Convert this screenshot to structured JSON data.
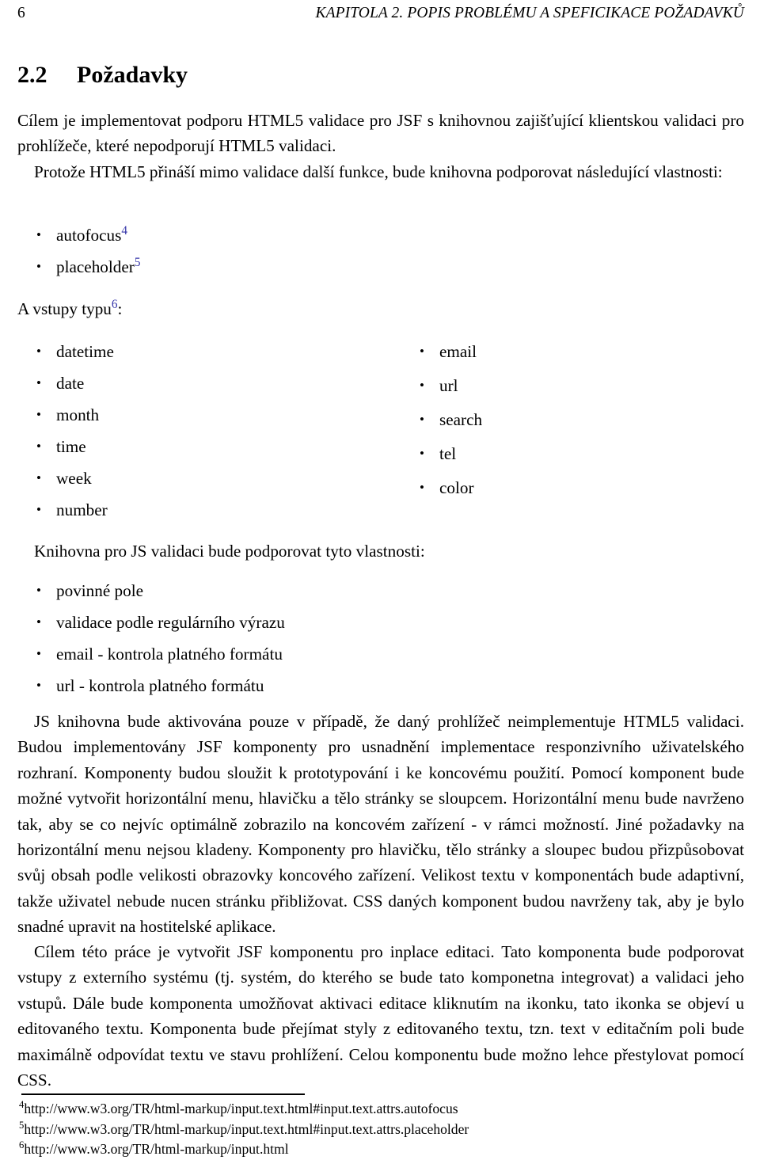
{
  "page": {
    "folio": "6",
    "running_head": "KAPITOLA 2. POPIS PROBLÉMU A SPEFICIKACE POŽADAVKŮ"
  },
  "section": {
    "number": "2.2",
    "title": "Požadavky"
  },
  "paragraphs": {
    "intro": "Cílem je implementovat podporu HTML5 validace pro JSF s knihovnou zajišťující klientskou validaci pro prohlížeče, které nepodporují HTML5 validaci.",
    "features_lead": "Protože HTML5 přináší mimo validace další funkce, bude knihovna podporovat následující vlastnosti:",
    "types_lead_before": "A vstupy typu",
    "types_lead_after": ":",
    "js_lead": "Knihovna pro JS validaci bude podporovat tyto vlastnosti:",
    "big_one": "JS knihovna bude aktivována pouze v případě, že daný prohlížeč neimplementuje HTML5 validaci. Budou implementovány JSF komponenty pro usnadnění implementace responzivního uživatelského rozhraní. Komponenty budou sloužit k prototypování i ke koncovému použití. Pomocí komponent bude možné vytvořit horizontální menu, hlavičku a tělo stránky se sloupcem. Horizontální menu bude navrženo tak, aby se co nejvíc optimálně zobrazilo na koncovém zařízení - v rámci možností. Jiné požadavky na horizontální menu nejsou kladeny. Komponenty pro hlavičku, tělo stránky a sloupec budou přizpůsobovat svůj obsah podle velikosti obrazovky koncového zařízení. Velikost textu v komponentách bude adaptivní, takže uživatel nebude nucen stránku přibližovat. CSS daných komponent budou navrženy tak, aby je bylo snadné upravit na hostitelské aplikace.",
    "big_two": "Cílem této práce je vytvořit JSF komponentu pro inplace editaci. Tato komponenta bude podporovat vstupy z externího systému (tj. systém, do kterého se bude tato komponetna integrovat) a validaci jeho vstupů. Dále bude komponenta umožňovat aktivaci editace kliknutím na ikonku, tato ikonka se objeví u editovaného textu. Komponenta bude přejímat styly z editovaného textu, tzn. text v editačním poli bude maximálně odpovídat textu ve stavu prohlížení. Celou komponentu bude možno lehce přestylovat pomocí CSS."
  },
  "html5_features": [
    {
      "label": "autofocus",
      "note": "4"
    },
    {
      "label": "placeholder",
      "note": "5"
    }
  ],
  "types_note": "6",
  "input_types_left": [
    "datetime",
    "date",
    "month",
    "time",
    "week",
    "number"
  ],
  "input_types_right": [
    "email",
    "url",
    "search",
    "tel",
    "color"
  ],
  "js_features": [
    "povinné pole",
    "validace podle regulárního výrazu",
    "email - kontrola platného formátu",
    "url - kontrola platného formátu"
  ],
  "footnotes": [
    {
      "num": "4",
      "text": "http://www.w3.org/TR/html-markup/input.text.html#input.text.attrs.autofocus"
    },
    {
      "num": "5",
      "text": "http://www.w3.org/TR/html-markup/input.text.html#input.text.attrs.placeholder"
    },
    {
      "num": "6",
      "text": "http://www.w3.org/TR/html-markup/input.html"
    }
  ],
  "colors": {
    "footnote_link": "#3434a8",
    "text": "#000000",
    "background": "#ffffff"
  }
}
